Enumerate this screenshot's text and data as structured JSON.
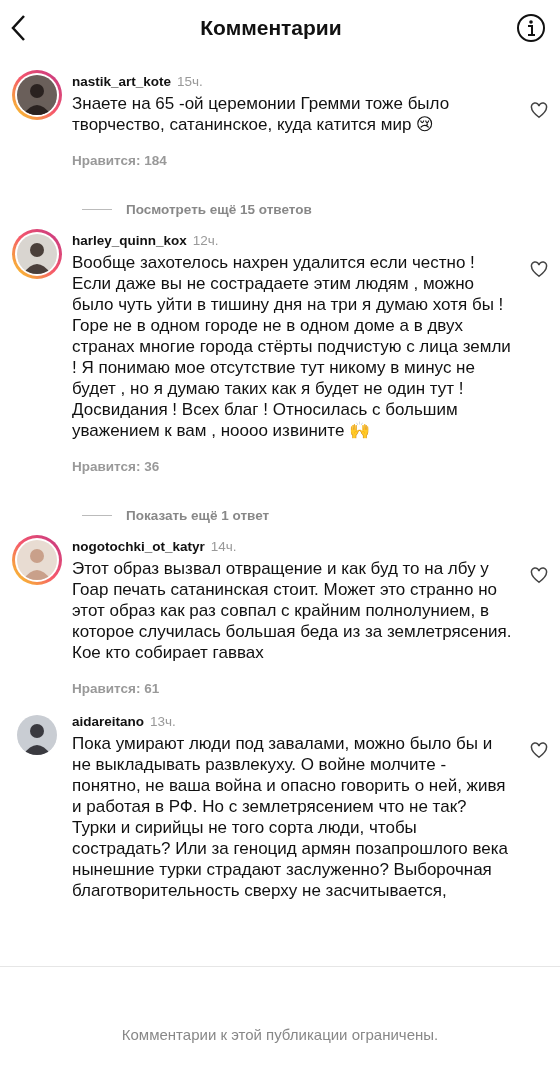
{
  "header": {
    "title": "Комментарии"
  },
  "comments": [
    {
      "username": "nastik_art_kote",
      "time": "15ч.",
      "text": "Знаете на 65 -ой церемонии Гремми тоже было творчество, сатанинское, куда катится мир 😢",
      "likes": "Нравится: 184",
      "story_ring": true,
      "liked": false,
      "replies_link": "Посмотреть ещё 15 ответов"
    },
    {
      "username": "harley_quinn_kox",
      "time": "12ч.",
      "text": "Вообще захотелось нахрен удалится если честно ! Если даже вы не сострадаете этим людям , можно было чуть уйти в тишину дня на три я думаю хотя бы ! Горе не в одном городе не в одном доме а в двух странах многие города стёрты подчистую с лица земли ! Я понимаю мое отсутствие тут никому в минус не будет , но я думаю таких как я будет не один тут ! Досвидания ! Всех благ ! Относилась с большим уважением к вам , ноооо извините 🙌",
      "likes": "Нравится: 36",
      "story_ring": true,
      "liked": false,
      "replies_link": "Показать ещё 1 ответ"
    },
    {
      "username": "nogotochki_ot_katyr",
      "time": "14ч.",
      "text": "Этот образ вызвал отвращение и как буд то на лбу у Гоар печать сатанинская стоит. Может это странно но этот образ как раз совпал с крайним полнолунием, в которое случилась большая беда из за землетрясения. Кое кто собирает гаввах",
      "likes": "Нравится: 61",
      "story_ring": true,
      "liked": false
    },
    {
      "username": "aidareitano",
      "time": "13ч.",
      "text": "Пока умирают люди под завалами, можно было бы и не выкладывать развлекуху. О войне молчите - понятно, не ваша война и опасно говорить о ней, живя и работая в РФ. Но с землетрясением что не так? Турки и сирийцы не того сорта люди, чтобы сострадать? Или за геноцид армян позапрошлого века нынешние турки страдают заслуженно? Выборочная благотворительность сверху не засчитывается,",
      "story_ring": false,
      "liked": false
    }
  ],
  "footer": {
    "notice": "Комментарии к этой публикации ограничены."
  }
}
